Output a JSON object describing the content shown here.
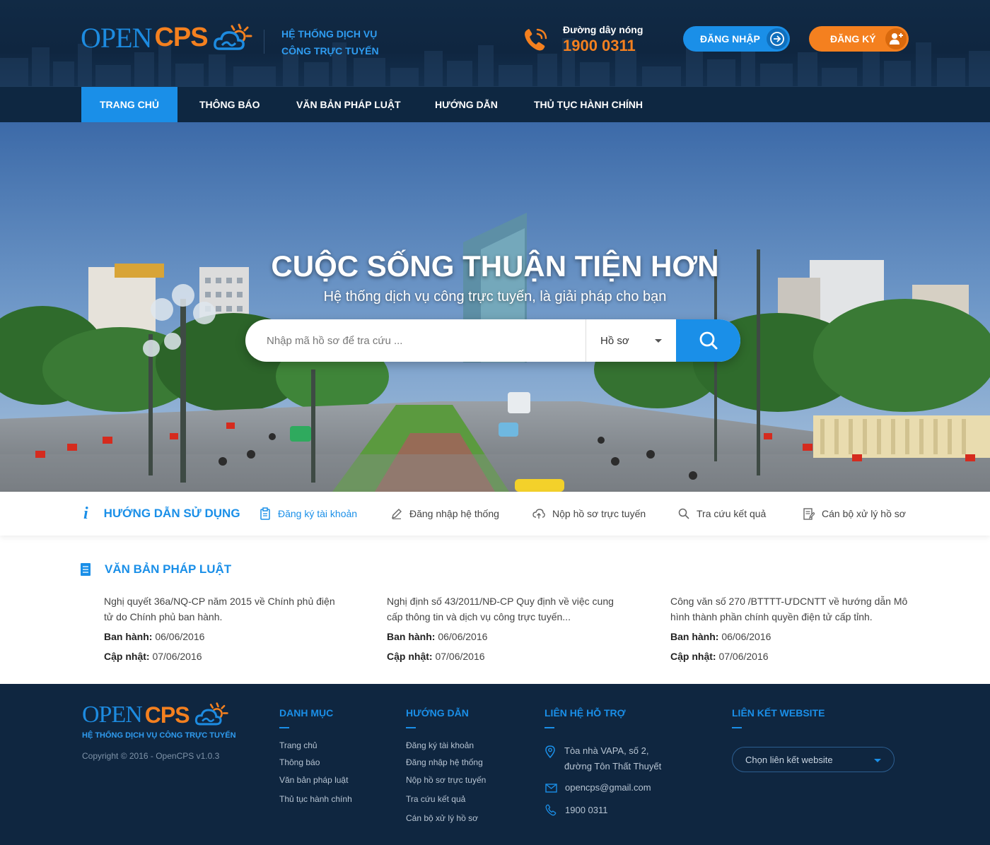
{
  "header": {
    "logo_open": "OPEN",
    "logo_cps": "CPS",
    "tagline_line1": "HỆ THỐNG DỊCH VỤ",
    "tagline_line2": "CÔNG TRỰC TUYẾN",
    "hotline_label": "Đường dây nóng",
    "hotline_number": "1900 0311",
    "login_label": "ĐĂNG NHẬP",
    "register_label": "ĐĂNG KÝ"
  },
  "nav": {
    "items": [
      {
        "label": "TRANG CHỦ",
        "active": true
      },
      {
        "label": "THÔNG BÁO"
      },
      {
        "label": "VĂN BẢN PHÁP LUẬT"
      },
      {
        "label": "HƯỚNG DẪN"
      },
      {
        "label": "THỦ TỤC HÀNH CHÍNH"
      }
    ]
  },
  "hero": {
    "title": "CUỘC SỐNG THUẬN TIỆN HƠN",
    "subtitle": "Hệ thống dịch vụ công trực tuyến, là giải pháp cho bạn",
    "search_placeholder": "Nhập mã hồ sơ để tra cứu ...",
    "search_type": "Hồ sơ"
  },
  "guide": {
    "title": "HƯỚNG DẪN SỬ DỤNG",
    "links": [
      {
        "label": "Đăng ký tài khoản",
        "icon": "clipboard-icon"
      },
      {
        "label": "Đăng nhập hệ thống",
        "icon": "pencil-icon"
      },
      {
        "label": "Nộp hồ sơ trực tuyến",
        "icon": "cloud-upload-icon"
      },
      {
        "label": "Tra cứu kết quả",
        "icon": "search-icon"
      },
      {
        "label": "Cán bộ xử lý hồ sơ",
        "icon": "edit-document-icon"
      }
    ]
  },
  "legal": {
    "title": "VĂN BẢN PHÁP LUẬT",
    "issued_label": "Ban hành:",
    "updated_label": "Cập nhật:",
    "docs": [
      {
        "title": "Nghị quyết 36a/NQ-CP năm 2015 về Chính phủ điện tử do Chính phủ ban hành.",
        "issued": "06/06/2016",
        "updated": "07/06/2016"
      },
      {
        "title": "Nghị định số 43/2011/NĐ-CP Quy định về việc cung cấp thông tin và dịch vụ công trực tuyến...",
        "issued": "06/06/2016",
        "updated": "07/06/2016"
      },
      {
        "title": "Công văn số 270 /BTTTT-ƯDCNTT về hướng dẫn Mô hình thành phần chính quyền điện tử cấp tỉnh.",
        "issued": "06/06/2016",
        "updated": "07/06/2016"
      }
    ]
  },
  "footer": {
    "logo_open": "OPEN",
    "logo_cps": "CPS",
    "tagline": "HỆ THỐNG DỊCH VỤ CÔNG TRỰC TUYẾN",
    "copyright": "Copyright © 2016 - OpenCPS v1.0.3",
    "categories": {
      "title": "DANH MỤC",
      "links": [
        "Trang chủ",
        "Thông báo",
        "Văn bản pháp luật",
        "Thủ tục hành chính"
      ]
    },
    "guides": {
      "title": "HƯỚNG DẪN",
      "links": [
        "Đăng ký tài khoản",
        "Đăng nhập hệ thống",
        "Nộp hồ sơ trực tuyến",
        "Tra cứu kết quả",
        "Cán bộ xử lý hồ sơ"
      ]
    },
    "contact": {
      "title": "LIÊN HỆ HỖ TRỢ",
      "address_line1": "Tòa nhà VAPA, số 2,",
      "address_line2": "đường Tôn Thất Thuyết",
      "email": "opencps@gmail.com",
      "phone": "1900 0311"
    },
    "websites": {
      "title": "LIÊN KẾT WEBSITE",
      "select_label": "Chọn liên kết website"
    }
  },
  "colors": {
    "primary": "#1a8fe8",
    "accent": "#f4801f",
    "header_bg": "#0f2640"
  }
}
